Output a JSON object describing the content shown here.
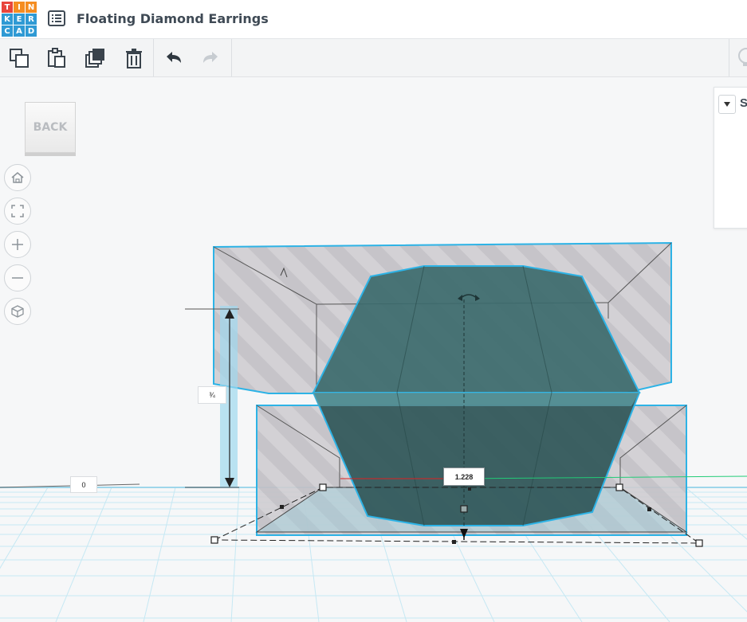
{
  "app": {
    "logo_letters": [
      "T",
      "I",
      "N",
      "K",
      "E",
      "R",
      "C",
      "A",
      "D"
    ],
    "logo_colors": [
      "#e8453c",
      "#f58d21",
      "#f58d21",
      "#2f9ad4",
      "#2f9ad4",
      "#2f9ad4",
      "#2f9ad4",
      "#2f9ad4",
      "#2f9ad4"
    ],
    "title": "Floating Diamond Earrings"
  },
  "toolbar": {
    "copy_icon": "copy-icon",
    "paste_icon": "paste-icon",
    "duplicate_icon": "duplicate-icon",
    "delete_icon": "trash-icon",
    "undo_icon": "undo-icon",
    "redo_icon": "redo-icon"
  },
  "viewcube": {
    "face_label": "BACK"
  },
  "nav": {
    "home_icon": "home-icon",
    "fit_icon": "fit-view-icon",
    "zoom_in_icon": "zoom-in-icon",
    "zoom_out_icon": "zoom-out-icon",
    "ortho_icon": "perspective-icon"
  },
  "panel": {
    "label": "S"
  },
  "dimensions": {
    "height_value": "¾",
    "elevation_value": "0",
    "width_value": "1.228"
  },
  "colors": {
    "accent": "#2db3e6",
    "gem_fill": "#2f5f62",
    "hole_fill": "#c9c9cc",
    "grid": "#bfe6f2"
  }
}
